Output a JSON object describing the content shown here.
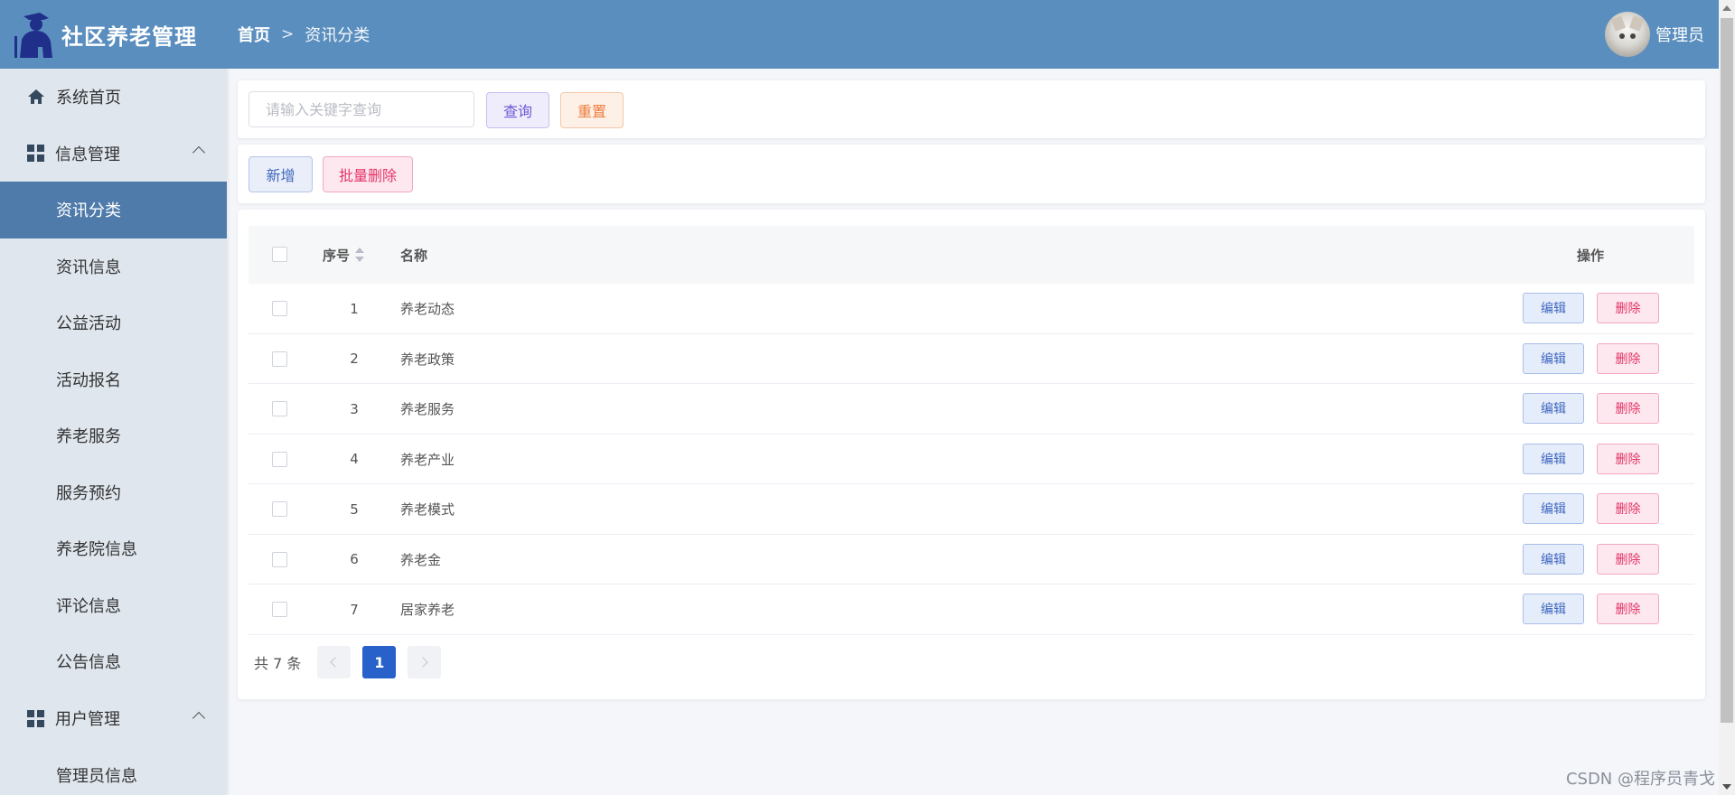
{
  "header": {
    "app_title": "社区养老管理",
    "breadcrumb": {
      "home": "首页",
      "separator": ">",
      "current": "资讯分类"
    },
    "user": {
      "name": "管理员"
    },
    "colors": {
      "header_bg": "#5a8ebe",
      "sidebar_active": "#4f7bab"
    }
  },
  "sidebar": {
    "home": "系统首页",
    "groups": [
      {
        "label": "信息管理",
        "items": [
          "资讯分类",
          "资讯信息",
          "公益活动",
          "活动报名",
          "养老服务",
          "服务预约",
          "养老院信息",
          "评论信息",
          "公告信息"
        ]
      },
      {
        "label": "用户管理",
        "items": [
          "管理员信息"
        ]
      }
    ],
    "active_item": "资讯分类"
  },
  "search": {
    "placeholder": "请输入关键字查询",
    "value": "",
    "query_label": "查询",
    "reset_label": "重置"
  },
  "actions": {
    "add_label": "新增",
    "batch_delete_label": "批量删除"
  },
  "table": {
    "columns": {
      "index": "序号",
      "name": "名称",
      "ops": "操作"
    },
    "edit_label": "编辑",
    "delete_label": "删除",
    "rows": [
      {
        "idx": "1",
        "name": "养老动态"
      },
      {
        "idx": "2",
        "name": "养老政策"
      },
      {
        "idx": "3",
        "name": "养老服务"
      },
      {
        "idx": "4",
        "name": "养老产业"
      },
      {
        "idx": "5",
        "name": "养老模式"
      },
      {
        "idx": "6",
        "name": "养老金"
      },
      {
        "idx": "7",
        "name": "居家养老"
      }
    ]
  },
  "pagination": {
    "total_text": "共 7 条",
    "current_page": "1"
  },
  "watermark": "CSDN @程序员青戈"
}
